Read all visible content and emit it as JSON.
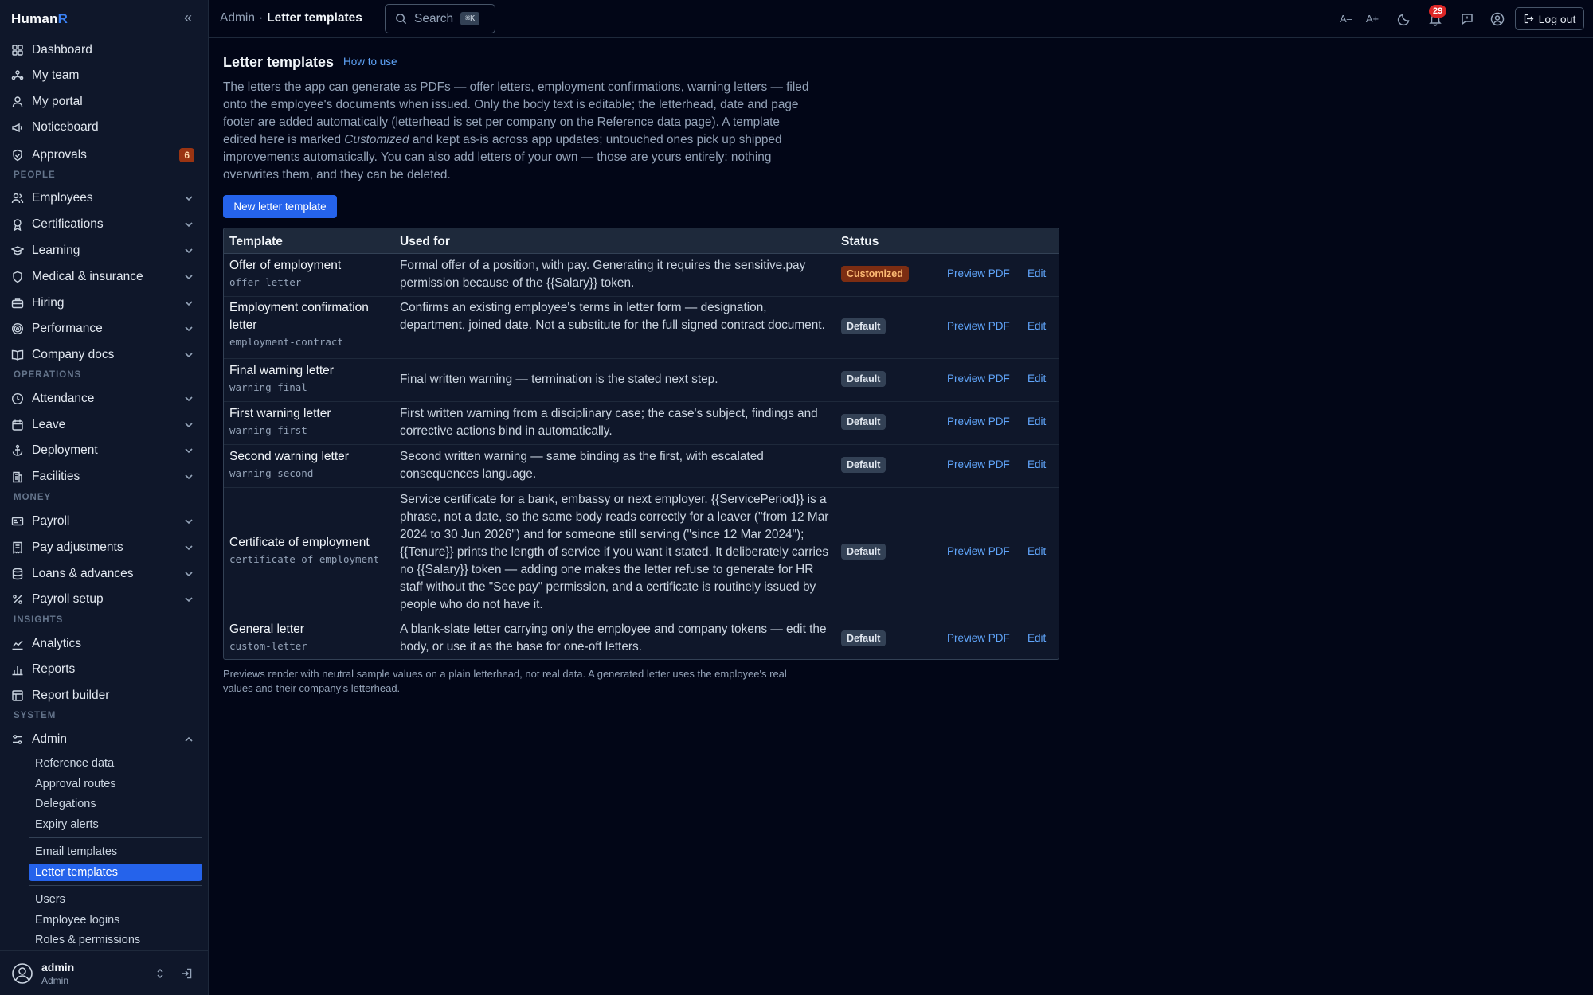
{
  "app": {
    "brand_main": "Human",
    "brand_accent": "R"
  },
  "topbar": {
    "crumb_parent": "Admin",
    "crumb_sep": "·",
    "crumb_current": "Letter templates",
    "search_placeholder": "Search",
    "search_shortcut": "⌘K",
    "font_decrease": "A–",
    "font_increase": "A+",
    "notification_count": "29",
    "logout_label": "Log out"
  },
  "sidebar": {
    "nav": [
      {
        "label": "Dashboard"
      },
      {
        "label": "My team"
      },
      {
        "label": "My portal"
      },
      {
        "label": "Noticeboard"
      },
      {
        "label": "Approvals",
        "badge": "6"
      }
    ],
    "sections": {
      "people": "PEOPLE",
      "operations": "OPERATIONS",
      "money": "MONEY",
      "insights": "INSIGHTS",
      "system": "SYSTEM"
    },
    "people": [
      {
        "label": "Employees"
      },
      {
        "label": "Certifications"
      },
      {
        "label": "Learning"
      },
      {
        "label": "Medical & insurance"
      },
      {
        "label": "Hiring"
      },
      {
        "label": "Performance"
      },
      {
        "label": "Company docs"
      }
    ],
    "operations": [
      {
        "label": "Attendance"
      },
      {
        "label": "Leave"
      },
      {
        "label": "Deployment"
      },
      {
        "label": "Facilities"
      }
    ],
    "money": [
      {
        "label": "Payroll"
      },
      {
        "label": "Pay adjustments"
      },
      {
        "label": "Loans & advances"
      },
      {
        "label": "Payroll setup"
      }
    ],
    "insights": [
      {
        "label": "Analytics"
      },
      {
        "label": "Reports"
      },
      {
        "label": "Report builder"
      }
    ],
    "system": [
      {
        "label": "Admin"
      }
    ],
    "admin_sub": [
      {
        "label": "Reference data"
      },
      {
        "label": "Approval routes"
      },
      {
        "label": "Delegations"
      },
      {
        "label": "Expiry alerts"
      },
      {
        "label": "Email templates"
      },
      {
        "label": "Letter templates"
      },
      {
        "label": "Users"
      },
      {
        "label": "Employee logins"
      },
      {
        "label": "Roles & permissions"
      }
    ],
    "user": {
      "name": "admin",
      "role": "Admin"
    }
  },
  "main": {
    "title": "Letter templates",
    "how_to_use": "How to use",
    "intro_1": "The letters the app can generate as PDFs — offer letters, employment confirmations, warning letters — filed onto the employee's documents when issued. Only the body text is editable; the letterhead, date and page footer are added automatically (letterhead is set per company on the Reference data page). A template edited here is marked ",
    "intro_em": "Customized",
    "intro_2": " and kept as-is across app updates; untouched ones pick up shipped improvements automatically. You can also add letters of your own — those are yours entirely: nothing overwrites them, and they can be deleted.",
    "new_button": "New letter template",
    "table": {
      "headers": {
        "template": "Template",
        "used_for": "Used for",
        "status": "Status"
      },
      "preview_label": "Preview PDF",
      "edit_label": "Edit",
      "rows": [
        {
          "name": "Offer of employment",
          "code": "offer-letter",
          "used": "Formal offer of a position, with pay. Generating it requires the sensitive.pay permission because of the {{Salary}} token.",
          "status": "Customized"
        },
        {
          "name": "Employment confirmation letter",
          "code": "employment-contract",
          "used": "Confirms an existing employee's terms in letter form — designation, department, joined date. Not a substitute for the full signed contract document.",
          "status": "Default"
        },
        {
          "name": "Final warning letter",
          "code": "warning-final",
          "used": "Final written warning — termination is the stated next step.",
          "status": "Default"
        },
        {
          "name": "First warning letter",
          "code": "warning-first",
          "used": "First written warning from a disciplinary case; the case's subject, findings and corrective actions bind in automatically.",
          "status": "Default"
        },
        {
          "name": "Second warning letter",
          "code": "warning-second",
          "used": "Second written warning — same binding as the first, with escalated consequences language.",
          "status": "Default"
        },
        {
          "name": "Certificate of employment",
          "code": "certificate-of-employment",
          "used": "Service certificate for a bank, embassy or next employer. {{ServicePeriod}} is a phrase, not a date, so the same body reads correctly for a leaver (\"from 12 Mar 2024 to 30 Jun 2026\") and for someone still serving (\"since 12 Mar 2024\"); {{Tenure}} prints the length of service if you want it stated. It deliberately carries no {{Salary}} token — adding one makes the letter refuse to generate for HR staff without the \"See pay\" permission, and a certificate is routinely issued by people who do not have it.",
          "status": "Default"
        },
        {
          "name": "General letter",
          "code": "custom-letter",
          "used": "A blank-slate letter carrying only the employee and company tokens — edit the body, or use it as the base for one-off letters.",
          "status": "Default"
        }
      ]
    },
    "footnote": "Previews render with neutral sample values on a plain letterhead, not real data. A generated letter uses the employee's real values and their company's letterhead."
  },
  "colors": {
    "background": "#020617",
    "sidebar": "#0f172a",
    "accent": "#2563eb",
    "link": "#60a5fa",
    "customized_badge": "#7c2d12",
    "notification": "#dc2626"
  }
}
